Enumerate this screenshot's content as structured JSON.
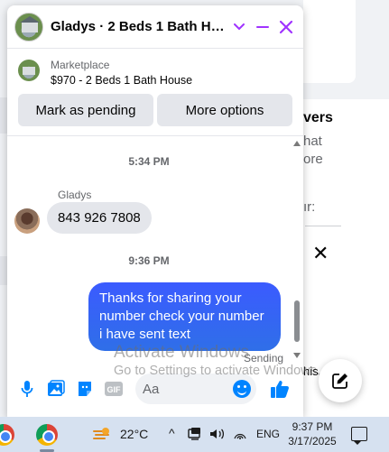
{
  "chat": {
    "title": "Gladys · 2 Beds 1 Bath House…",
    "marketplace": {
      "label": "Marketplace",
      "listing": "$970 - 2 Beds 1 Bath House"
    },
    "buttons": {
      "mark_pending": "Mark as pending",
      "more_options": "More options"
    },
    "messages": [
      {
        "type": "timestamp",
        "text": "5:34 PM"
      },
      {
        "type": "incoming",
        "sender": "Gladys",
        "text": "843 926 7808"
      },
      {
        "type": "timestamp",
        "text": "9:36 PM"
      },
      {
        "type": "outgoing",
        "text": "Thanks for sharing your number check your number i have sent text",
        "status": "Sending"
      }
    ],
    "composer": {
      "placeholder": "Aa"
    }
  },
  "background": {
    "heading_fragment": "vers",
    "line1": "hat",
    "line2": "ore",
    "line3": "ır:",
    "line4": "his."
  },
  "watermark": {
    "title": "Activate Windows",
    "subtitle": "Go to Settings to activate Windows."
  },
  "taskbar": {
    "temperature": "22°C",
    "language": "ENG",
    "time": "9:37 PM",
    "date": "3/17/2025"
  },
  "colors": {
    "accent": "#a033ff",
    "outgoing_bubble": "#3b5bff",
    "messenger_blue": "#0084ff"
  }
}
